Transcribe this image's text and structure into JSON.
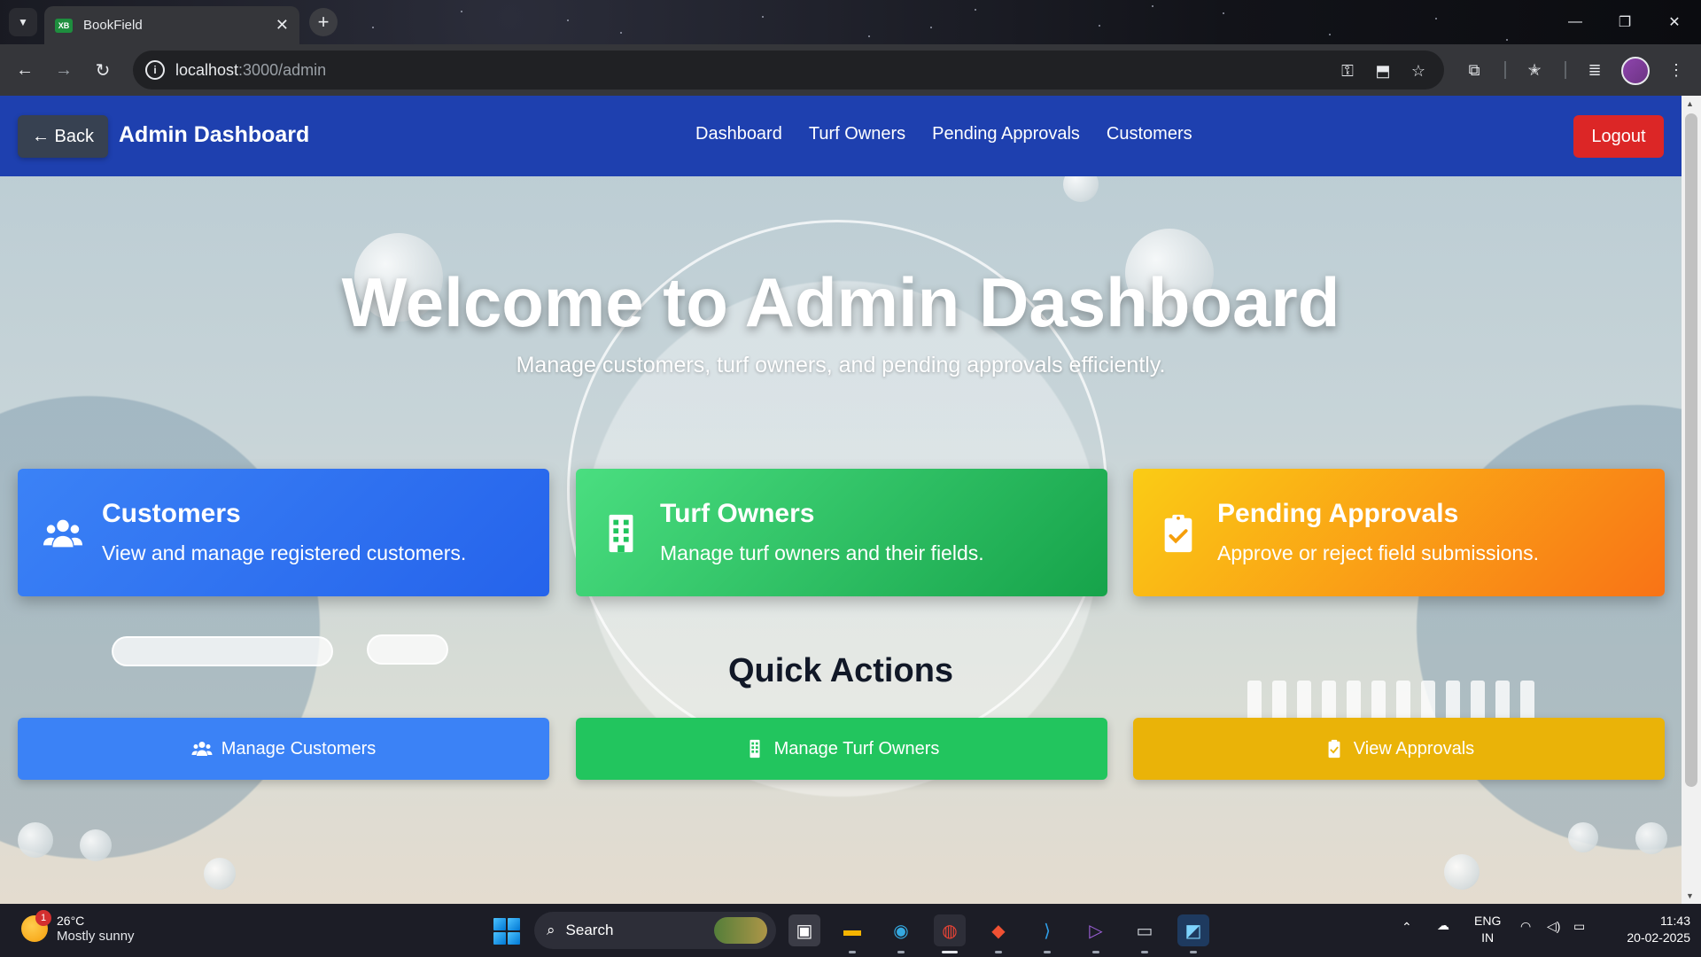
{
  "browser": {
    "tab_title": "BookField",
    "tab_favicon": "XB",
    "url_host": "localhost",
    "url_path": ":3000/admin",
    "icons": [
      "tab-search-icon",
      "close-icon",
      "new-tab-icon",
      "back-icon",
      "forward-icon",
      "reload-icon",
      "site-info-icon",
      "password-key-icon",
      "install-app-icon",
      "bookmark-star-icon",
      "extensions-icon",
      "favorites-icon",
      "media-control-icon",
      "profile-avatar",
      "more-menu-icon"
    ]
  },
  "nav": {
    "back_label": "← Back",
    "brand": "Admin Dashboard",
    "links": [
      "Dashboard",
      "Turf Owners",
      "Pending Approvals",
      "Customers"
    ],
    "logout_label": "Logout"
  },
  "hero": {
    "title": "Welcome to Admin Dashboard",
    "subtitle": "Manage customers, turf owners, and pending approvals efficiently."
  },
  "cards": [
    {
      "title": "Customers",
      "description": "View and manage registered customers.",
      "icon": "users-icon",
      "color": "#3b82f6"
    },
    {
      "title": "Turf Owners",
      "description": "Manage turf owners and their fields.",
      "icon": "building-icon",
      "color": "#22c55e"
    },
    {
      "title": "Pending Approvals",
      "description": "Approve or reject field submissions.",
      "icon": "clipboard-check-icon",
      "color": "#f97316"
    }
  ],
  "quick_actions": {
    "title": "Quick Actions",
    "buttons": [
      {
        "label": "Manage Customers",
        "icon": "users-icon",
        "color": "#3b82f6"
      },
      {
        "label": "Manage Turf Owners",
        "icon": "building-icon",
        "color": "#22c55e"
      },
      {
        "label": "View Approvals",
        "icon": "clipboard-check-icon",
        "color": "#eab308"
      }
    ]
  },
  "taskbar": {
    "weather_temp": "26°C",
    "weather_desc": "Mostly sunny",
    "weather_badge": "1",
    "search_label": "Search",
    "lang_top": "ENG",
    "lang_bottom": "IN",
    "time": "11:43",
    "date": "20-02-2025"
  },
  "colors": {
    "nav_bg": "#1e40af",
    "logout_bg": "#dc2626",
    "back_bg": "#374151"
  }
}
